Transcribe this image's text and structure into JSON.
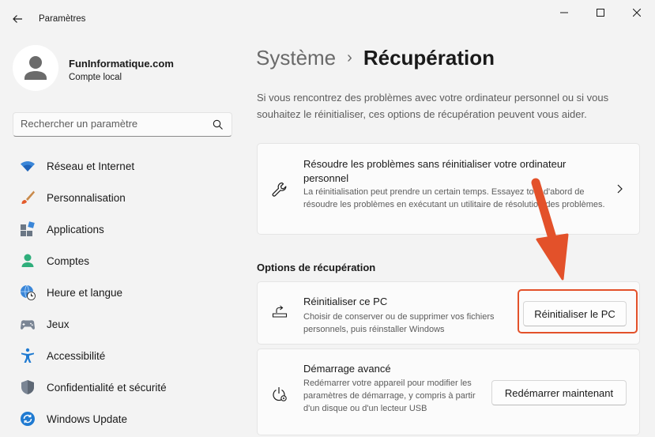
{
  "window": {
    "title": "Paramètres",
    "controls": [
      "minimize",
      "maximize",
      "close"
    ]
  },
  "profile": {
    "name": "FunInformatique.com",
    "account_type": "Compte local"
  },
  "search": {
    "placeholder": "Rechercher un paramètre"
  },
  "sidebar": {
    "items": [
      {
        "label": "Réseau et Internet",
        "icon": "wifi-icon"
      },
      {
        "label": "Personnalisation",
        "icon": "paintbrush-icon"
      },
      {
        "label": "Applications",
        "icon": "apps-icon"
      },
      {
        "label": "Comptes",
        "icon": "user-icon"
      },
      {
        "label": "Heure et langue",
        "icon": "globe-clock-icon"
      },
      {
        "label": "Jeux",
        "icon": "gamepad-icon"
      },
      {
        "label": "Accessibilité",
        "icon": "accessibility-icon"
      },
      {
        "label": "Confidentialité et sécurité",
        "icon": "shield-icon"
      },
      {
        "label": "Windows Update",
        "icon": "windows-update-icon"
      }
    ]
  },
  "breadcrumb": {
    "parent": "Système",
    "separator": "›",
    "current": "Récupération"
  },
  "intro": "Si vous rencontrez des problèmes avec votre ordinateur personnel ou si vous souhaitez le réinitialiser, ces options de récupération peuvent vous aider.",
  "troubleshoot": {
    "title": "Résoudre les problèmes sans réinitialiser votre ordinateur personnel",
    "description": "La réinitialisation peut prendre un certain temps. Essayez tout d'abord de résoudre les problèmes en exécutant un utilitaire de résolution des problèmes."
  },
  "section_title": "Options de récupération",
  "reset": {
    "title": "Réinitialiser ce PC",
    "description": "Choisir de conserver ou de supprimer vos fichiers personnels, puis réinstaller Windows",
    "button": "Réinitialiser le PC"
  },
  "advanced": {
    "title": "Démarrage avancé",
    "description": "Redémarrer votre appareil pour modifier les paramètres de démarrage, y compris à partir d'un disque ou d'un lecteur USB",
    "button": "Redémarrer maintenant"
  },
  "colors": {
    "accent": "#0067c0",
    "highlight": "#e3512a",
    "background": "#f3f3f3",
    "card": "#fbfbfb"
  }
}
